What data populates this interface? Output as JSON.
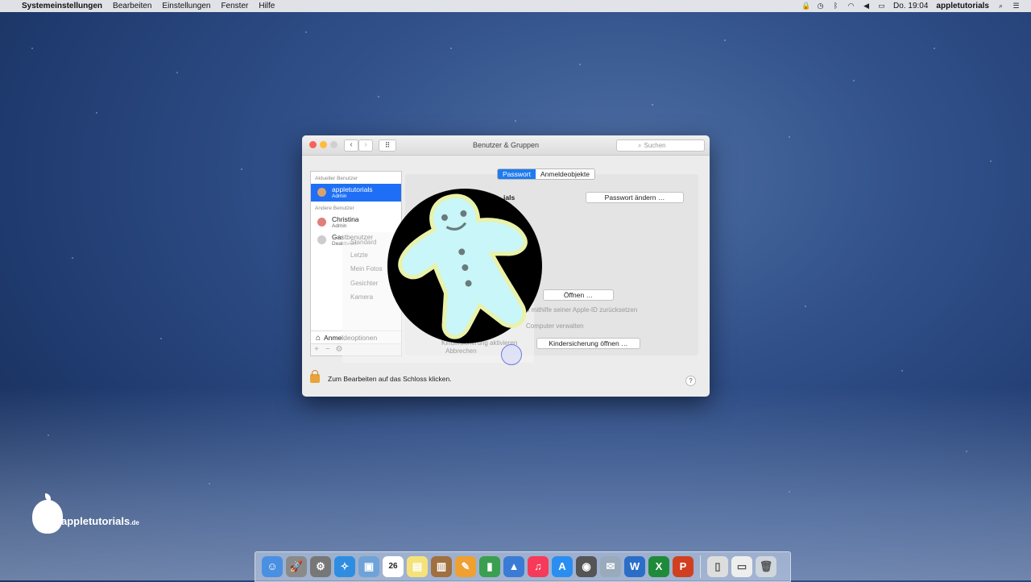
{
  "menubar": {
    "apple": "",
    "app": "Systemeinstellungen",
    "menus": [
      "Bearbeiten",
      "Einstellungen",
      "Fenster",
      "Hilfe"
    ],
    "clock": "Do. 19:04",
    "user": "appletutorials"
  },
  "window": {
    "title": "Benutzer & Gruppen",
    "search_placeholder": "Suchen",
    "sidebar": {
      "current_section": "Aktueller Benutzer",
      "current_user": {
        "name": "appletutorials",
        "role": "Admin"
      },
      "other_section": "Andere Benutzer",
      "others": [
        {
          "name": "Christina",
          "role": "Admin"
        },
        {
          "name": "Gastbenutzer",
          "role": "Deaktiviert"
        }
      ],
      "login_options": "Anmeldeoptionen",
      "tools": [
        "+",
        "−",
        "⚙"
      ]
    },
    "tabs": [
      {
        "label": "Passwort",
        "active": true
      },
      {
        "label": "Anmeldeobjekte",
        "active": false
      }
    ],
    "user_name_partial": "ials",
    "change_password": "Passwort ändern …",
    "open_button": "Öffnen …",
    "reset_text": "n mithilfe seiner Apple-ID zurücksetzen",
    "manage_text": "Computer verwalten",
    "parental_button": "Kindersicherung öffnen …",
    "ghost_items": [
      "Standard",
      "Letzte",
      "Mein Fotos",
      "Gesichter",
      "Kamera"
    ],
    "ghost_check": "Kindersicherung aktivieren",
    "ghost_cancel": "Abbrechen",
    "lock_text": "Zum Bearbeiten auf das Schloss klicken.",
    "help": "?"
  },
  "watermark": {
    "brand": "appletutorials",
    "tld": ".de"
  },
  "dock": {
    "calendar_day": "26",
    "items": [
      "finder-icon",
      "launchpad-icon",
      "system-preferences-icon",
      "safari-icon",
      "preview-icon",
      "calendar-icon",
      "notes-icon",
      "contacts-icon",
      "pages-icon",
      "numbers-icon",
      "keynote-icon",
      "itunes-icon",
      "app-store-icon",
      "photo-booth-icon",
      "mail-icon",
      "word-icon",
      "excel-icon",
      "powerpoint-icon"
    ]
  }
}
